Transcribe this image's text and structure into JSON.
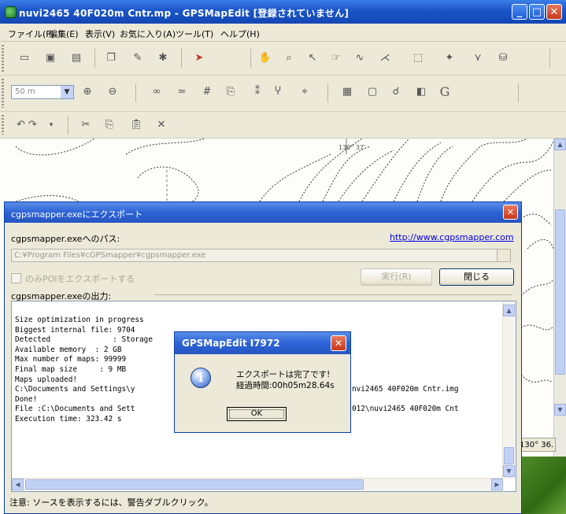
{
  "window": {
    "title": "nuvi2465 40F020m Cntr.mp - GPSMapEdit [登録されていません]",
    "controls": [
      "_",
      "□",
      "✕"
    ]
  },
  "menu": [
    "ファイル(F)",
    "編集(E)",
    "表示(V)",
    "お気に入り(A)",
    "ツール(T)",
    "ヘルプ(H)"
  ],
  "toolbar": {
    "scale_value": "50 m",
    "g_button": "G"
  },
  "map": {
    "label_130_37": "130° 37'",
    "coord_readout": "130° 36."
  },
  "export_dialog": {
    "title": "cgpsmapper.exeにエクスポート",
    "path_label": "cgpsmapper.exeへのパス:",
    "link_text": "http://www.cgpsmapper.com",
    "path_value": "C:¥Program Files¥cGPSmapper¥cgpsmapper.exe",
    "poi_only_label": "のみPOIをエクスポートする",
    "run_button": "実行(R)",
    "close_button": "閉じる",
    "output_label": "cgpsmapper.exeの出力:",
    "output_lines": [
      "Size optimization in progress",
      "Biggest internal file: 9704",
      "Detected              : Storage",
      "Available memory  : 2 GB",
      "Max number of maps: 99999",
      "Final map size     : 9 MB",
      "Maps uploaded!",
      "C:\\Documents and Settings\\y",
      "Done!",
      "File :C:\\Documents and Sett",
      "Execution time: 323.42 s"
    ],
    "output_tail_lines": [
      "nvi2465 40F020m Cntr.img",
      "012\\nuvi2465 40F020m Cnt"
    ],
    "status_text": "注意: ソースを表示するには、警告ダブルクリック。"
  },
  "message_box": {
    "title": "GPSMapEdit I7972",
    "line1": "エクスポートは完了です!",
    "line2": "経過時間:00h05m28.64s",
    "ok_button": "OK"
  },
  "colors": {
    "title_blue": "#1a55c9",
    "close_red": "#c8391b",
    "dialog_face": "#ece9d8",
    "link_blue": "#0000ee"
  }
}
